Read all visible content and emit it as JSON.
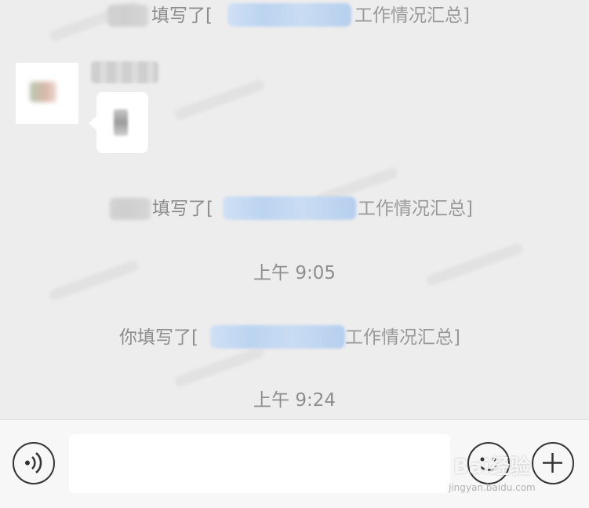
{
  "messages": {
    "sys1": {
      "prefix": "填写了[",
      "suffix": "工作情况汇总]"
    },
    "sys2": {
      "prefix": "填写了[",
      "suffix": "工作情况汇总]"
    },
    "time1": "上午 9:05",
    "sys3": {
      "prefix": "你填写了[",
      "suffix": "工作情况汇总]"
    },
    "time2": "上午 9:24"
  },
  "input_bar": {
    "placeholder": "",
    "voice_icon": "voice-icon",
    "emoji_icon": "emoji-icon",
    "plus_icon": "plus-icon"
  },
  "watermark": {
    "brand": "Bai经验",
    "url": "jingyan.baidu.com"
  },
  "colors": {
    "background": "#ededed",
    "link": "#4a7fbf",
    "system_text": "#8e8e8e",
    "bubble": "#ffffff"
  }
}
